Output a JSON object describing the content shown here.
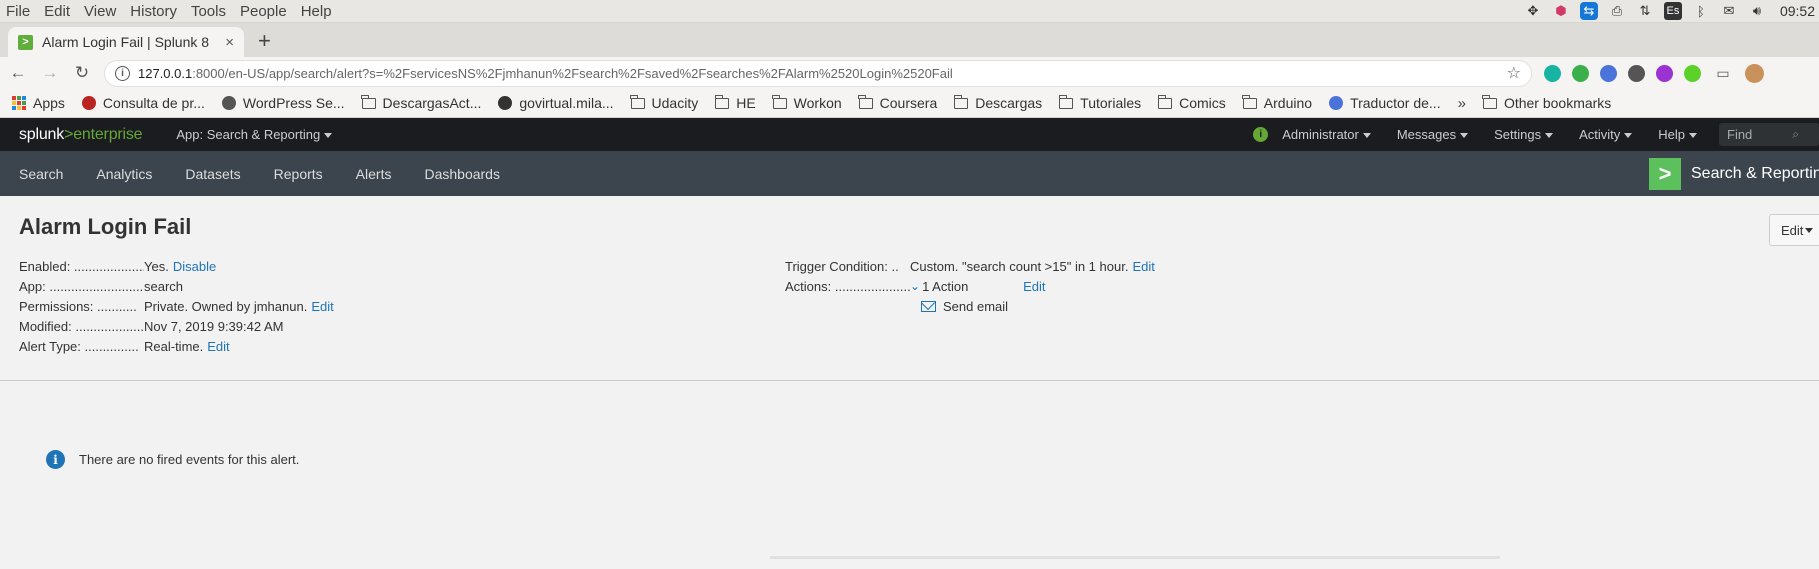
{
  "os": {
    "menu": [
      "File",
      "Edit",
      "View",
      "History",
      "Tools",
      "People",
      "Help"
    ],
    "tray_icons": [
      "dropbox-icon",
      "app-icon",
      "teamviewer-icon",
      "printer-icon",
      "network-icon",
      "keyboard-layout-icon",
      "bluetooth-icon",
      "mail-icon",
      "volume-icon"
    ],
    "keyboard_layout": "Es",
    "clock": "09:52"
  },
  "browser": {
    "tab_title": "Alarm Login Fail | Splunk 8",
    "tab_close": "×",
    "new_tab": "+",
    "url_host": "127.0.0.1",
    "url_rest": ":8000/en-US/app/search/alert?s=%2FservicesNS%2Fjmhanun%2Fsearch%2Fsaved%2Fsearches%2FAlarm%2520Login%2520Fail",
    "extensions": [
      "#17b3a3",
      "#3bb04a",
      "#4a74d9",
      "#555555",
      "#9b32d1",
      "#5bd12a"
    ],
    "bookmarks": [
      {
        "label": "Apps",
        "icon": "apps"
      },
      {
        "label": "Consulta de pr...",
        "icon": "site"
      },
      {
        "label": "WordPress Se...",
        "icon": "site"
      },
      {
        "label": "DescargasAct...",
        "icon": "folder"
      },
      {
        "label": "govirtual.mila...",
        "icon": "site"
      },
      {
        "label": "Udacity",
        "icon": "folder"
      },
      {
        "label": "HE",
        "icon": "folder"
      },
      {
        "label": "Workon",
        "icon": "folder"
      },
      {
        "label": "Coursera",
        "icon": "folder"
      },
      {
        "label": "Descargas",
        "icon": "folder"
      },
      {
        "label": "Tutoriales",
        "icon": "folder"
      },
      {
        "label": "Comics",
        "icon": "folder"
      },
      {
        "label": "Arduino",
        "icon": "folder"
      },
      {
        "label": "Traductor de...",
        "icon": "site"
      }
    ],
    "bookmarks_more": "»",
    "other_bookmarks": "Other bookmarks"
  },
  "splunk": {
    "logo_a": "splunk",
    "logo_gt": ">",
    "logo_b": "enterprise",
    "app_menu": "App: Search & Reporting",
    "status_icon": "i",
    "menus": [
      "Administrator",
      "Messages",
      "Settings",
      "Activity",
      "Help"
    ],
    "find_placeholder": "Find"
  },
  "appbar": {
    "nav": [
      "Search",
      "Analytics",
      "Datasets",
      "Reports",
      "Alerts",
      "Dashboards"
    ],
    "brand_icon": ">",
    "brand_title": "Search & Reporting"
  },
  "alert": {
    "title": "Alarm Login Fail",
    "edit_button": "Edit",
    "left": [
      {
        "label": "Enabled: ....................",
        "value": "Yes.",
        "link": "Disable"
      },
      {
        "label": "App: ................................",
        "value": "search",
        "link": ""
      },
      {
        "label": "Permissions: ...........",
        "value": "Private. Owned by jmhanun.",
        "link": "Edit"
      },
      {
        "label": "Modified: ...................",
        "value": "Nov 7, 2019 9:39:42 AM",
        "link": ""
      },
      {
        "label": "Alert Type: ...............",
        "value": "Real-time.",
        "link": "Edit"
      }
    ],
    "trigger_label": "Trigger Condition: ..",
    "trigger_value": "Custom. \"search count >15\" in 1 hour.",
    "trigger_link": "Edit",
    "actions_label": "Actions: .....................",
    "actions_value": "1 Action",
    "actions_link": "Edit",
    "action_item": "Send email",
    "empty_notice": "There are no fired events for this alert."
  }
}
